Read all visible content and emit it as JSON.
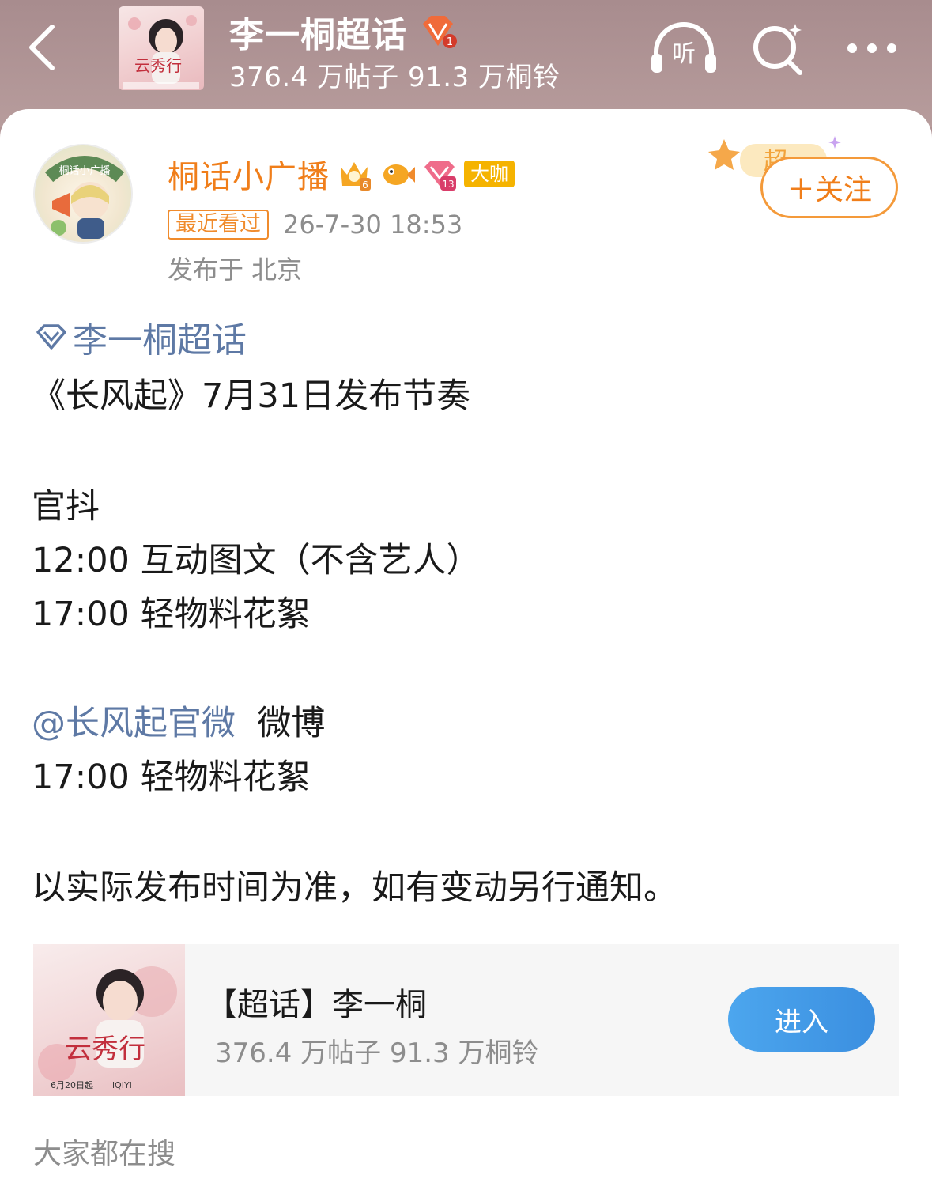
{
  "header": {
    "topic_title": "李一桐超话",
    "topic_level": "1",
    "topic_stats": "376.4 万帖子 91.3 万桐铃",
    "listen_label": "听",
    "icons": {
      "back": "chevron-left-icon",
      "listen": "headphones-icon",
      "search": "search-icon",
      "more": "more-icon"
    }
  },
  "post": {
    "author": {
      "name": "桐话小广播",
      "crown_level": "6",
      "super_level": "13",
      "daka_label": "大咖",
      "avatar_text": "桐话小广播"
    },
    "recent_tag": "最近看过",
    "time": "26-7-30 18:53",
    "location": "发布于 北京",
    "follow_label": "＋关注",
    "follow_deco_text": "超",
    "topic_link": "李一桐超话",
    "lines": {
      "l1": "《长风起》7月31日发布节奏",
      "l2": "官抖",
      "l3": "12:00 互动图文（不含艺人）",
      "l4": "17:00 轻物料花絮",
      "l5_mention": "@长风起官微",
      "l5_rest": "微博",
      "l6": "17:00  轻物料花絮",
      "l7": "以实际发布时间为准，如有变动另行通知。"
    }
  },
  "topic_card": {
    "name": "【超话】李一桐",
    "stats": "376.4 万帖子 91.3 万桐铃",
    "enter_label": "进入",
    "poster_title": "云秀行",
    "poster_date": "6月20日起",
    "poster_platform": "iQIYI"
  },
  "footer": {
    "everyone_search": "大家都在搜"
  },
  "colors": {
    "header_bg": "#b09394",
    "accent_orange": "#f07e1a",
    "link_blue": "#5e79a5",
    "enter_blue": "#3b8fe0",
    "muted_gray": "#8d8d8d"
  }
}
